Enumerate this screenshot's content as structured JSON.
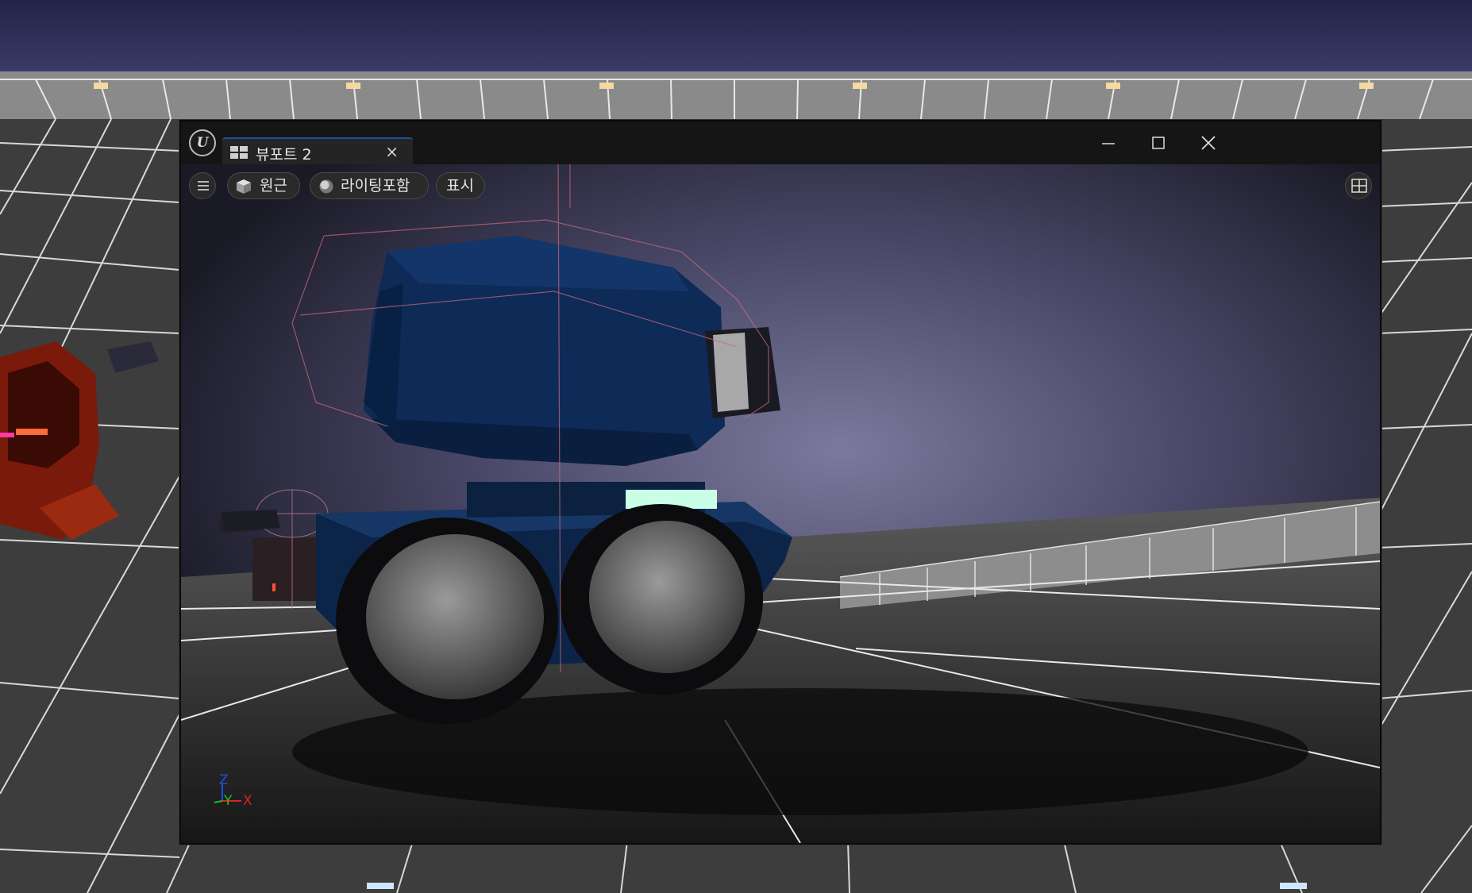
{
  "window": {
    "tab_label": "뷰포트 2",
    "tab_close": "×"
  },
  "toolbar": {
    "menu_icon": "hamburger-icon",
    "perspective_label": "원근",
    "lighting_label": "라이팅포함",
    "show_label": "표시",
    "layout_icon": "viewport-layout-icon"
  },
  "axis_gizmo": {
    "z": "Z",
    "y": "Y",
    "x": "X"
  },
  "colors": {
    "sky": "#2c2c55",
    "robot_body": "#0c2a55",
    "accent_tab": "#1e4fa0",
    "axis_x": "#e02020",
    "axis_y": "#20c020",
    "axis_z": "#2050e0"
  }
}
